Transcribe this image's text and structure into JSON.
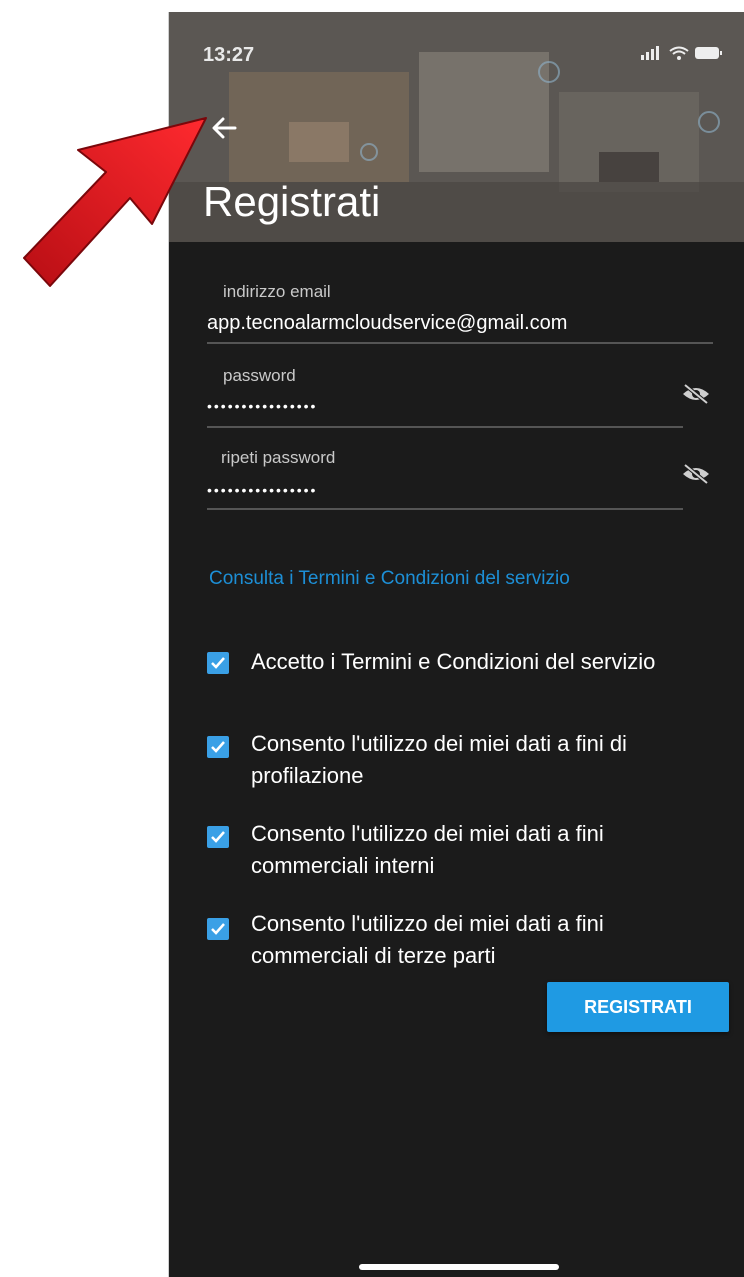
{
  "status_bar": {
    "time": "13:27"
  },
  "header": {
    "title": "Registrati"
  },
  "form": {
    "email": {
      "label": "indirizzo email",
      "value": "app.tecnoalarmcloudservice@gmail.com"
    },
    "password": {
      "label": "password",
      "value": "••••••••••••••••"
    },
    "repeat_password": {
      "label": "ripeti password",
      "value": "••••••••••••••••"
    }
  },
  "terms_link": "Consulta i Termini e Condizioni del servizio",
  "consents": [
    {
      "text": "Accetto i Termini e Condizioni del servizio",
      "checked": true
    },
    {
      "text": "Consento l'utilizzo dei miei dati a fini di profilazione",
      "checked": true
    },
    {
      "text": "Consento l'utilizzo dei miei dati a fini commerciali interni",
      "checked": true
    },
    {
      "text": "Consento l'utilizzo dei miei dati a fini commerciali di terze parti",
      "checked": true
    }
  ],
  "submit_label": "REGISTRATI",
  "colors": {
    "background": "#1b1b1b",
    "accent": "#1f9ae3",
    "link": "#1d8fd6",
    "annotation_arrow": "#e0141c"
  },
  "icons": [
    "back-arrow-icon",
    "eye-off-icon",
    "checkbox-checked-icon",
    "signal-icon",
    "wifi-icon",
    "battery-icon"
  ]
}
